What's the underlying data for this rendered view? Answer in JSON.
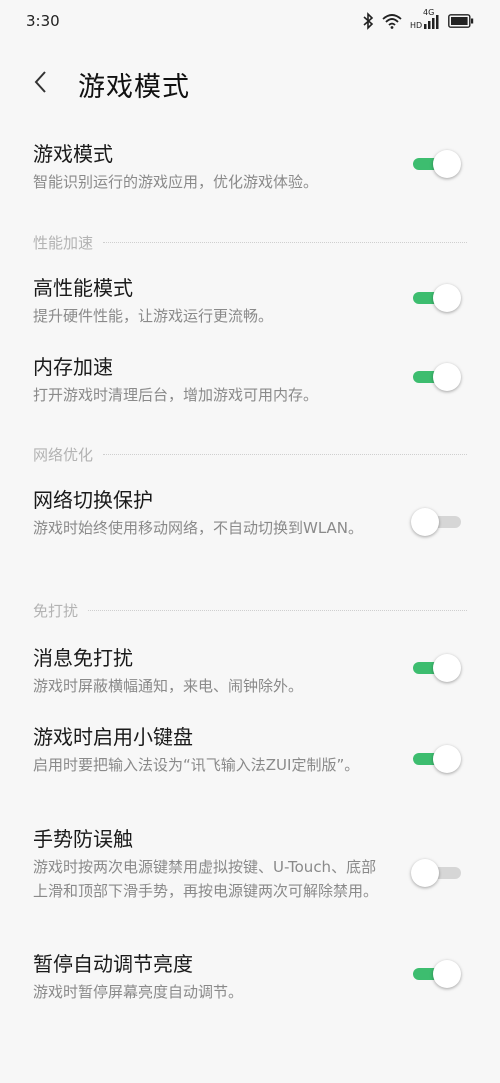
{
  "status_bar": {
    "time": "3:30",
    "network_label": "4G",
    "icons": [
      "bluetooth-icon",
      "wifi-icon",
      "hd-signal-icon",
      "battery-icon"
    ]
  },
  "header": {
    "title": "游戏模式",
    "back_icon": "chevron-left-icon"
  },
  "sections": {
    "performance": "性能加速",
    "network": "网络优化",
    "dnd": "免打扰"
  },
  "settings": {
    "game_mode": {
      "title": "游戏模式",
      "desc": "智能识别运行的游戏应用，优化游戏体验。",
      "enabled": true
    },
    "high_performance": {
      "title": "高性能模式",
      "desc": "提升硬件性能，让游戏运行更流畅。",
      "enabled": true
    },
    "memory_boost": {
      "title": "内存加速",
      "desc": "打开游戏时清理后台，增加游戏可用内存。",
      "enabled": true
    },
    "network_switch": {
      "title": "网络切换保护",
      "desc": "游戏时始终使用移动网络，不自动切换到WLAN。",
      "enabled": false
    },
    "message_dnd": {
      "title": "消息免打扰",
      "desc": "游戏时屏蔽横幅通知，来电、闹钟除外。",
      "enabled": true
    },
    "small_keyboard": {
      "title": "游戏时启用小键盘",
      "desc": "启用时要把输入法设为“讯飞输入法ZUI定制版”。",
      "enabled": true
    },
    "gesture_guard": {
      "title": "手势防误触",
      "desc": "游戏时按两次电源键禁用虚拟按键、U-Touch、底部上滑和顶部下滑手势，再按电源键两次可解除禁用。",
      "enabled": false
    },
    "pause_brightness": {
      "title": "暂停自动调节亮度",
      "desc": "游戏时暂停屏幕亮度自动调节。",
      "enabled": true
    }
  },
  "colors": {
    "accent": "#3dbd6f",
    "toggle_off": "#d6d6d6",
    "background": "#f7f7f7"
  }
}
